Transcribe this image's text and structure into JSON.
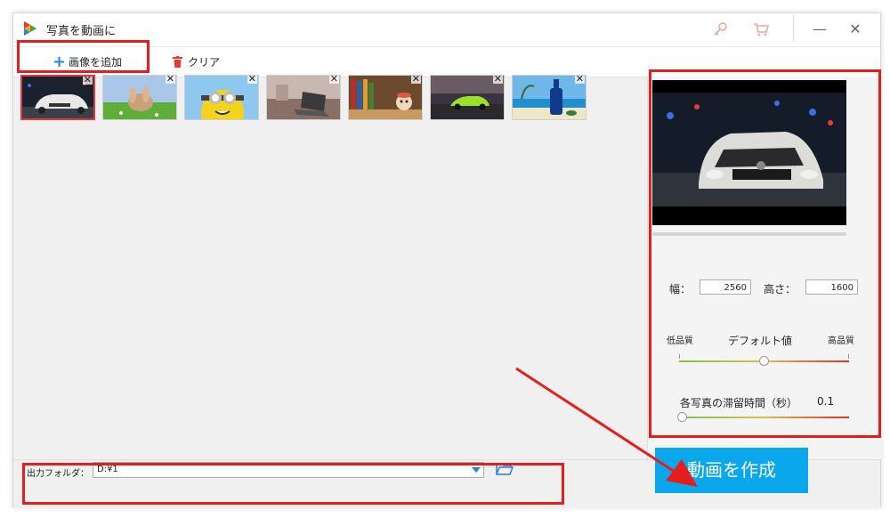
{
  "window": {
    "title": "写真を動画に"
  },
  "titlebar": {
    "key_icon": "key-icon",
    "cart_icon": "cart-icon",
    "minimize": "—",
    "close": "✕"
  },
  "toolbar": {
    "add_label": "画像を追加",
    "clear_label": "クリア"
  },
  "thumbnails": [
    {
      "name": "white-sports-car",
      "selected": true
    },
    {
      "name": "rabbit-in-grass",
      "selected": false
    },
    {
      "name": "minion-cartoon",
      "selected": false
    },
    {
      "name": "laptop-on-desk",
      "selected": false
    },
    {
      "name": "bookshelf-with-toy",
      "selected": false
    },
    {
      "name": "green-sports-car",
      "selected": false
    },
    {
      "name": "beach-wine-bottle",
      "selected": false
    }
  ],
  "settings": {
    "width_label": "幅：",
    "width_value": "2560",
    "height_label": "高さ：",
    "height_value": "1600",
    "quality_low": "低品質",
    "quality_default": "デフォルト値",
    "quality_high": "高品質",
    "quality_level": 0.5,
    "duration_label": "各写真の滞留時間（秒）",
    "duration_value": "0.1",
    "duration_level": 0.0
  },
  "output": {
    "label": "出力フォルダ：",
    "path": "D:¥1"
  },
  "create_button": "動画を作成",
  "colors": {
    "accent": "#0aa7ec",
    "highlight": "#e41d1d",
    "plus": "#1e88e5",
    "trash": "#e53935"
  }
}
